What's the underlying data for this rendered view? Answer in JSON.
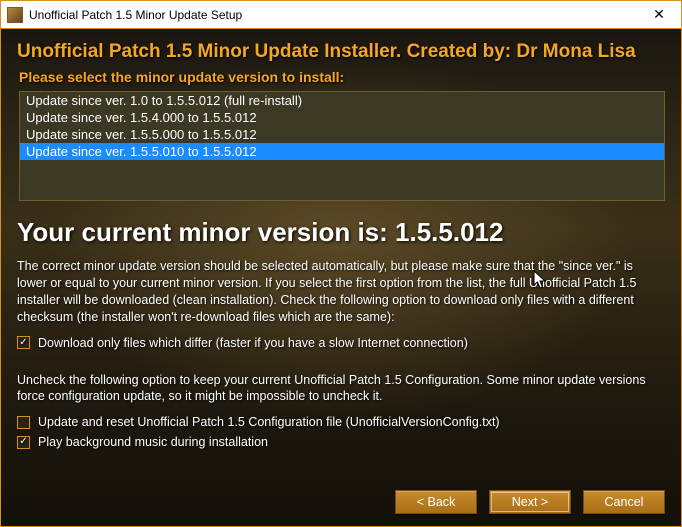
{
  "window": {
    "title": "Unofficial Patch 1.5 Minor Update Setup"
  },
  "heading": "Unofficial Patch 1.5 Minor Update Installer. Created by: Dr Mona Lisa",
  "subheading": "Please select the minor update version to install:",
  "list": {
    "items": [
      {
        "label": "Update since ver. 1.0 to 1.5.5.012 (full re-install)",
        "selected": false
      },
      {
        "label": "Update since ver. 1.5.4.000 to 1.5.5.012",
        "selected": false
      },
      {
        "label": "Update since ver. 1.5.5.000 to 1.5.5.012",
        "selected": false
      },
      {
        "label": "Update since ver. 1.5.5.010 to 1.5.5.012",
        "selected": true
      }
    ]
  },
  "current_version_line": "Your current minor version is: 1.5.5.012",
  "paragraph1": "The correct minor update version should be selected automatically, but please make sure that the \"since ver.\" is lower or equal to your current minor version. If you select the first option from the list, the full Unofficial Patch 1.5 installer will be downloaded (clean installation). Check the following option to download only files with a different checksum (the installer won't re-download files which are the same):",
  "checkbox1": {
    "checked": true,
    "label": "Download only files which differ (faster if you have a slow Internet connection)"
  },
  "paragraph2": "Uncheck the following option to keep your current Unofficial Patch 1.5 Configuration. Some minor update versions force configuration update, so it might be impossible to uncheck it.",
  "checkbox2": {
    "checked": false,
    "label": "Update and reset Unofficial Patch 1.5 Configuration file (UnofficialVersionConfig.txt)"
  },
  "checkbox3": {
    "checked": true,
    "label": "Play background music during installation"
  },
  "buttons": {
    "back": "< Back",
    "next": "Next >",
    "cancel": "Cancel"
  }
}
